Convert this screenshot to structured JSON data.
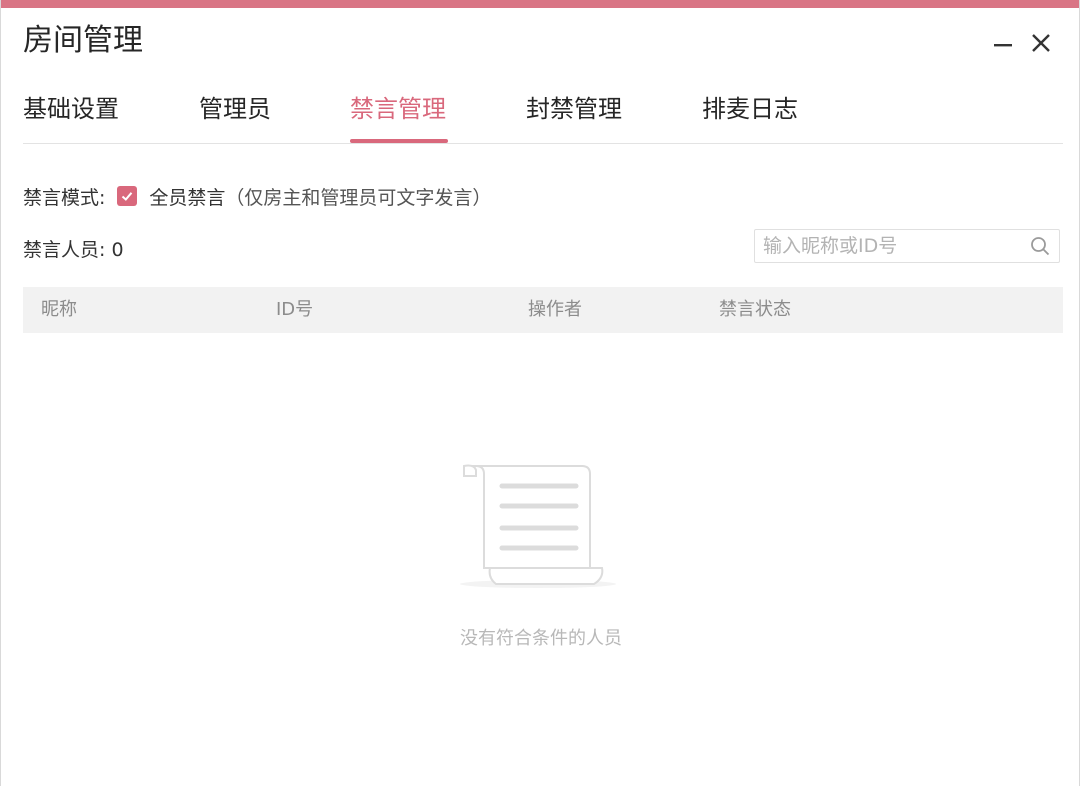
{
  "window": {
    "title": "房间管理",
    "accent_color": "#d9687c"
  },
  "controls": {
    "minimize_icon": "minimize-icon",
    "close_icon": "close-icon"
  },
  "tabs": [
    {
      "label": "基础设置",
      "active": false
    },
    {
      "label": "管理员",
      "active": false
    },
    {
      "label": "禁言管理",
      "active": true
    },
    {
      "label": "封禁管理",
      "active": false
    },
    {
      "label": "排麦日志",
      "active": false
    }
  ],
  "mute_mode": {
    "label": "禁言模式:",
    "checked": true,
    "option_label": "全员禁言",
    "hint": "（仅房主和管理员可文字发言）"
  },
  "muted_count": {
    "text": "禁言人员: 0"
  },
  "search": {
    "placeholder": "输入昵称或ID号",
    "value": ""
  },
  "table": {
    "columns": [
      "昵称",
      "ID号",
      "操作者",
      "禁言状态"
    ],
    "rows": []
  },
  "empty_state": {
    "icon": "scroll-icon",
    "text": "没有符合条件的人员"
  }
}
